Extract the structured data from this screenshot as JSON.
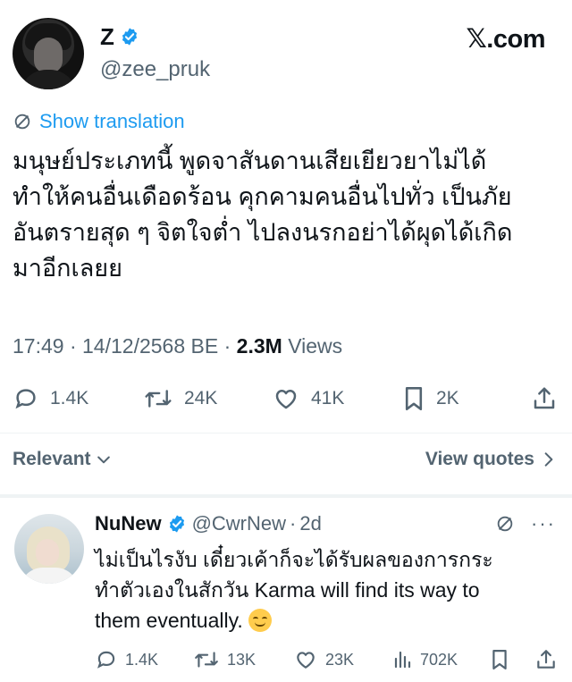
{
  "tweet": {
    "author": {
      "display_name": "Z",
      "handle": "@zee_pruk",
      "verified": true
    },
    "watermark": "𝕏.com",
    "show_translation": "Show translation",
    "text": "มนุษย์ประเภทนี้ พูดจาสันดานเสียเยียวยาไม่ได้\nทำให้คนอื่นเดือดร้อน คุกคามคนอื่นไปทั่ว เป็นภัย\nอันตรายสุด ๆ จิตใจต่ำ ไปลงนรกอย่าได้ผุดได้เกิด\nมาอีกเลยย",
    "time": "17:49",
    "separator": "·",
    "date": "14/12/2568 BE",
    "views_count": "2.3M",
    "views_label": "Views",
    "stats": {
      "replies": "1.4K",
      "retweets": "24K",
      "likes": "41K",
      "bookmarks": "2K"
    }
  },
  "filter": {
    "sort_label": "Relevant",
    "view_quotes": "View quotes"
  },
  "reply": {
    "display_name": "NuNew",
    "handle": "@CwrNew",
    "separator": "·",
    "age": "2d",
    "text": "ไม่เป็นไรงับ เดี๋ยวเค้าก็จะได้รับผลของการกระ\nทำตัวเองในสักวัน Karma will find its way to\nthem eventually. ",
    "stats": {
      "replies": "1.4K",
      "retweets": "13K",
      "likes": "23K",
      "views": "702K"
    }
  },
  "colors": {
    "accent": "#1d9bf0",
    "muted": "#536471",
    "text": "#0f1419",
    "verified": "#1d9bf0"
  },
  "icons": {
    "verified": "verified-badge-icon",
    "translate": "globe-icon",
    "reply": "speech-bubble-icon",
    "retweet": "retweet-icon",
    "like": "heart-icon",
    "bookmark": "bookmark-icon",
    "share": "share-icon",
    "views": "bar-chart-icon",
    "more": "more-dots-icon",
    "chevron_down": "chevron-down-icon",
    "chevron_right": "chevron-right-icon",
    "emoji": "smiling-face-emoji"
  }
}
